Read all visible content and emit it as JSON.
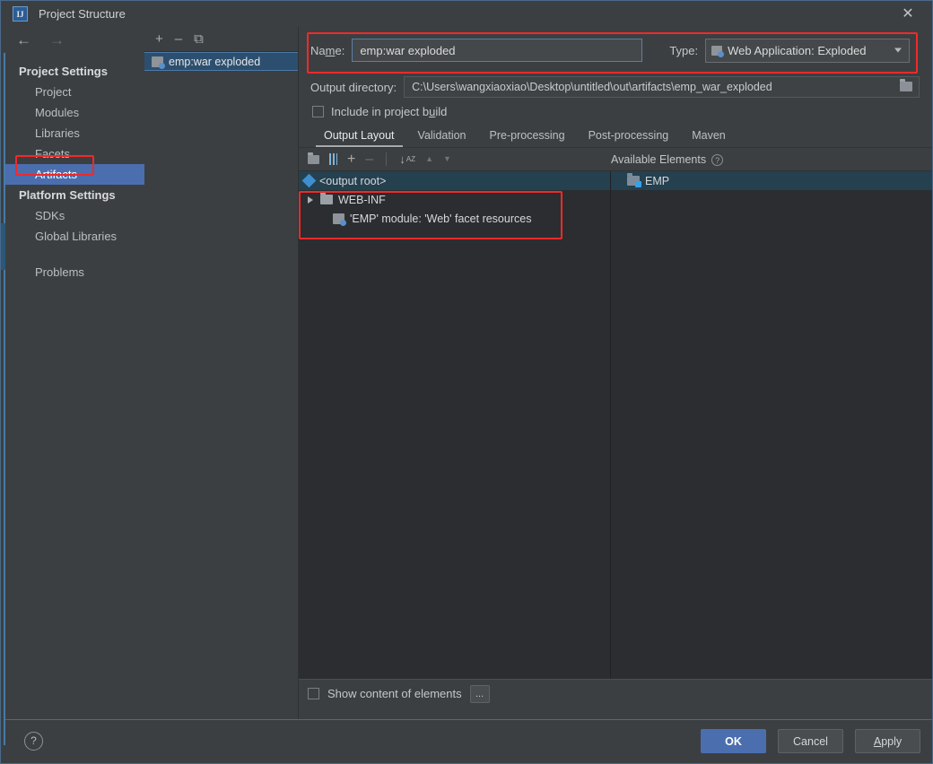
{
  "window": {
    "title": "Project Structure",
    "app_icon": "IJ",
    "close_icon": "close-icon"
  },
  "nav": {
    "back_icon": "arrow-left-icon",
    "forward_icon": "arrow-right-icon",
    "groups": [
      {
        "label": "Project Settings",
        "items": [
          {
            "label": "Project",
            "selected": false
          },
          {
            "label": "Modules",
            "selected": false
          },
          {
            "label": "Libraries",
            "selected": false
          },
          {
            "label": "Facets",
            "selected": false
          },
          {
            "label": "Artifacts",
            "selected": true
          }
        ]
      },
      {
        "label": "Platform Settings",
        "items": [
          {
            "label": "SDKs",
            "selected": false
          },
          {
            "label": "Global Libraries",
            "selected": false
          }
        ]
      }
    ],
    "extra": [
      {
        "label": "Problems",
        "selected": false
      }
    ]
  },
  "artifacts_panel": {
    "toolbar": [
      {
        "name": "add-artifact-button",
        "glyph": "+"
      },
      {
        "name": "remove-artifact-button",
        "glyph": "–"
      },
      {
        "name": "copy-artifact-button",
        "glyph": "⧉"
      }
    ],
    "items": [
      {
        "label": "emp:war exploded",
        "icon": "artifact-icon",
        "selected": true
      }
    ]
  },
  "detail": {
    "name_label": "Name:",
    "name_value": "emp:war exploded",
    "type_label": "Type:",
    "type_value": "Web Application: Exploded",
    "type_icon": "artifact-icon",
    "output_dir_label": "Output directory:",
    "output_dir_value": "C:\\Users\\wangxiaoxiao\\Desktop\\untitled\\out\\artifacts\\emp_war_exploded",
    "browse_icon": "folder-icon",
    "include_build_label": "Include in project build",
    "include_build_checked": false,
    "tabs": [
      {
        "label": "Output Layout",
        "active": true
      },
      {
        "label": "Validation",
        "active": false
      },
      {
        "label": "Pre-processing",
        "active": false
      },
      {
        "label": "Post-processing",
        "active": false
      },
      {
        "label": "Maven",
        "active": false
      }
    ],
    "elem_toolbar": [
      {
        "name": "create-directory-button",
        "glyph": "◰"
      },
      {
        "name": "create-archive-button",
        "glyph": "‖"
      },
      {
        "name": "add-element-button",
        "glyph": "+"
      },
      {
        "name": "remove-element-button",
        "glyph": "–"
      },
      {
        "name": "sort-button",
        "glyph": "↓"
      },
      {
        "name": "move-up-button",
        "glyph": "▲"
      },
      {
        "name": "move-down-button",
        "glyph": "▼"
      }
    ],
    "available_elements_label": "Available Elements",
    "available_elements_help_icon": "question-mark-icon",
    "tree": [
      {
        "label": "<output root>",
        "icon": "output-root-icon",
        "indent": 0,
        "expander": false,
        "selected": true
      },
      {
        "label": "WEB-INF",
        "icon": "folder-icon",
        "indent": 1,
        "expander": true,
        "selected": false
      },
      {
        "label": "'EMP' module: 'Web' facet resources",
        "icon": "module-icon",
        "indent": 2,
        "expander": false,
        "selected": false
      }
    ],
    "available_elements": [
      {
        "label": "EMP",
        "icon": "web-module-icon",
        "selected": true
      }
    ],
    "show_content_label": "Show content of elements",
    "show_content_checked": false,
    "ellipsis_label": "..."
  },
  "footer": {
    "help_label": "?",
    "ok_label": "OK",
    "cancel_label": "Cancel",
    "apply_label": "Apply"
  },
  "annotations": {
    "accent_red": "#ef2a2a",
    "selection_blue": "#4b6eaf"
  }
}
